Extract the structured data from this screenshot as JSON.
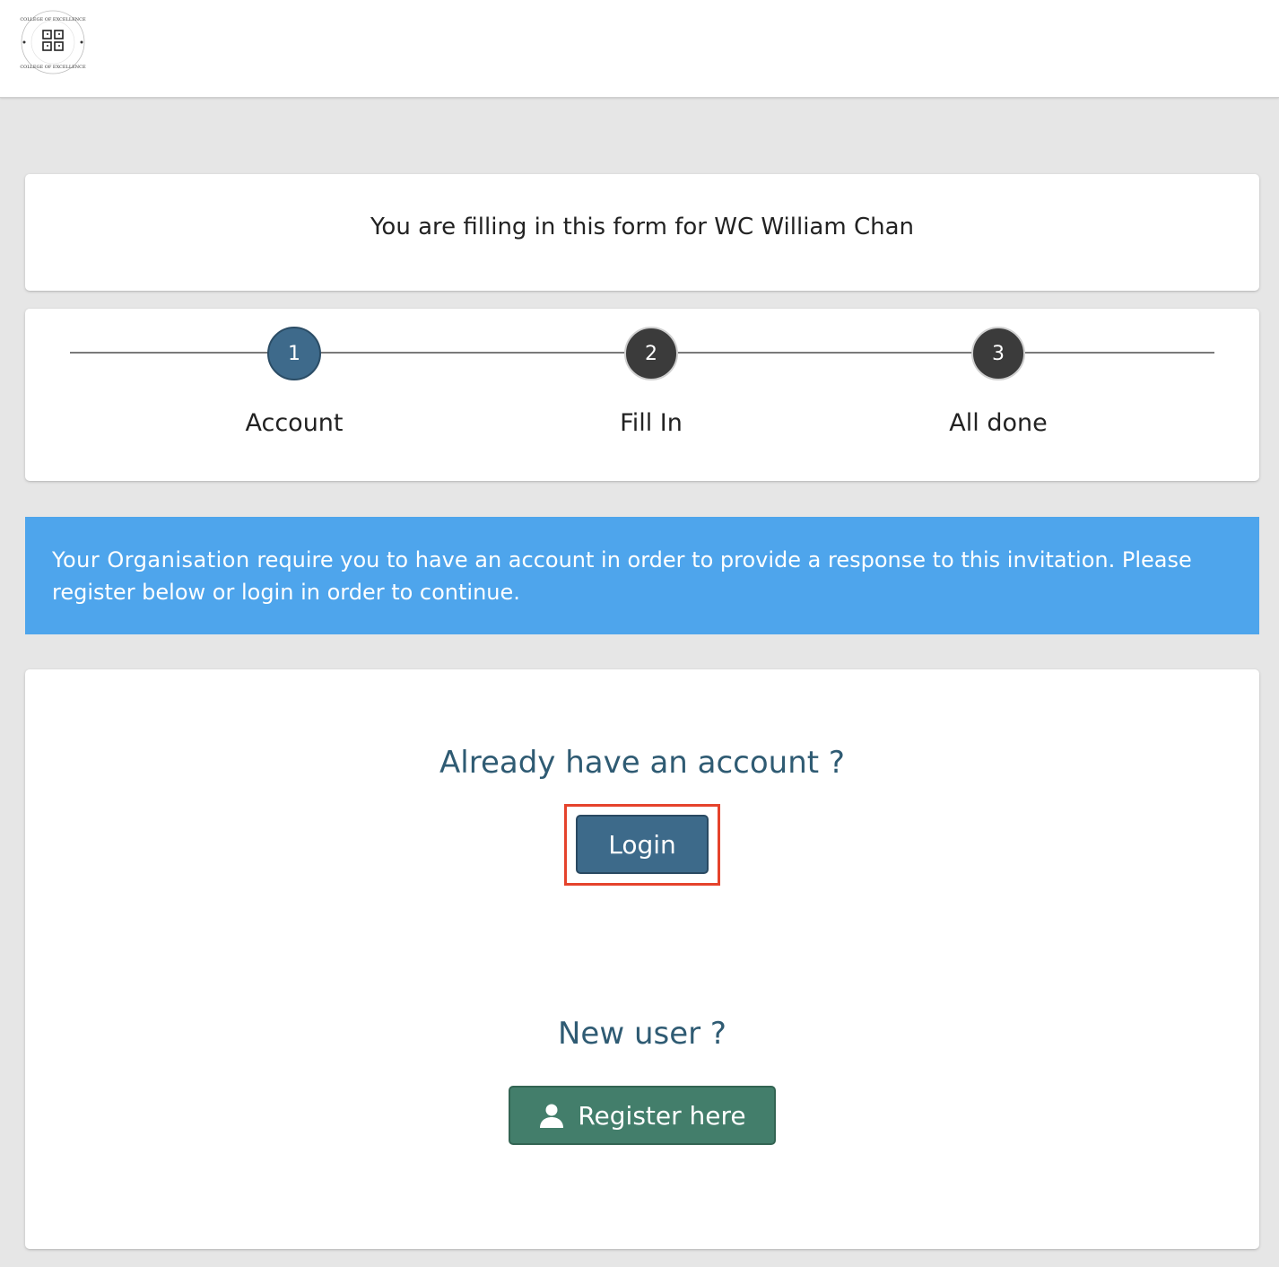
{
  "header": {
    "logo_icon": "college-of-excellence-seal",
    "logo_text": "COLLEGE OF EXCELLENCE"
  },
  "intro": {
    "text": "You are filling in this form for WC William Chan"
  },
  "steps": [
    {
      "number": "1",
      "label": "Account",
      "state": "active"
    },
    {
      "number": "2",
      "label": "Fill In",
      "state": "todo"
    },
    {
      "number": "3",
      "label": "All done",
      "state": "todo"
    }
  ],
  "banner": {
    "org": "Your Organisation",
    "text_line1": " require you to have an account in order to provide a response to this invitation. Please",
    "text_line2": "register below or login in order to continue."
  },
  "auth": {
    "login_heading": "Already have an account ?",
    "login_label": "Login",
    "new_heading": "New user ?",
    "register_label": "Register here",
    "register_icon": "user-icon"
  },
  "colors": {
    "active_step": "#3e6a8b",
    "pending_step": "#3b3b3b",
    "banner": "#4ea5ec",
    "login_button": "#3d6a8a",
    "register_button": "#437e6b",
    "highlight": "#e5432c"
  }
}
